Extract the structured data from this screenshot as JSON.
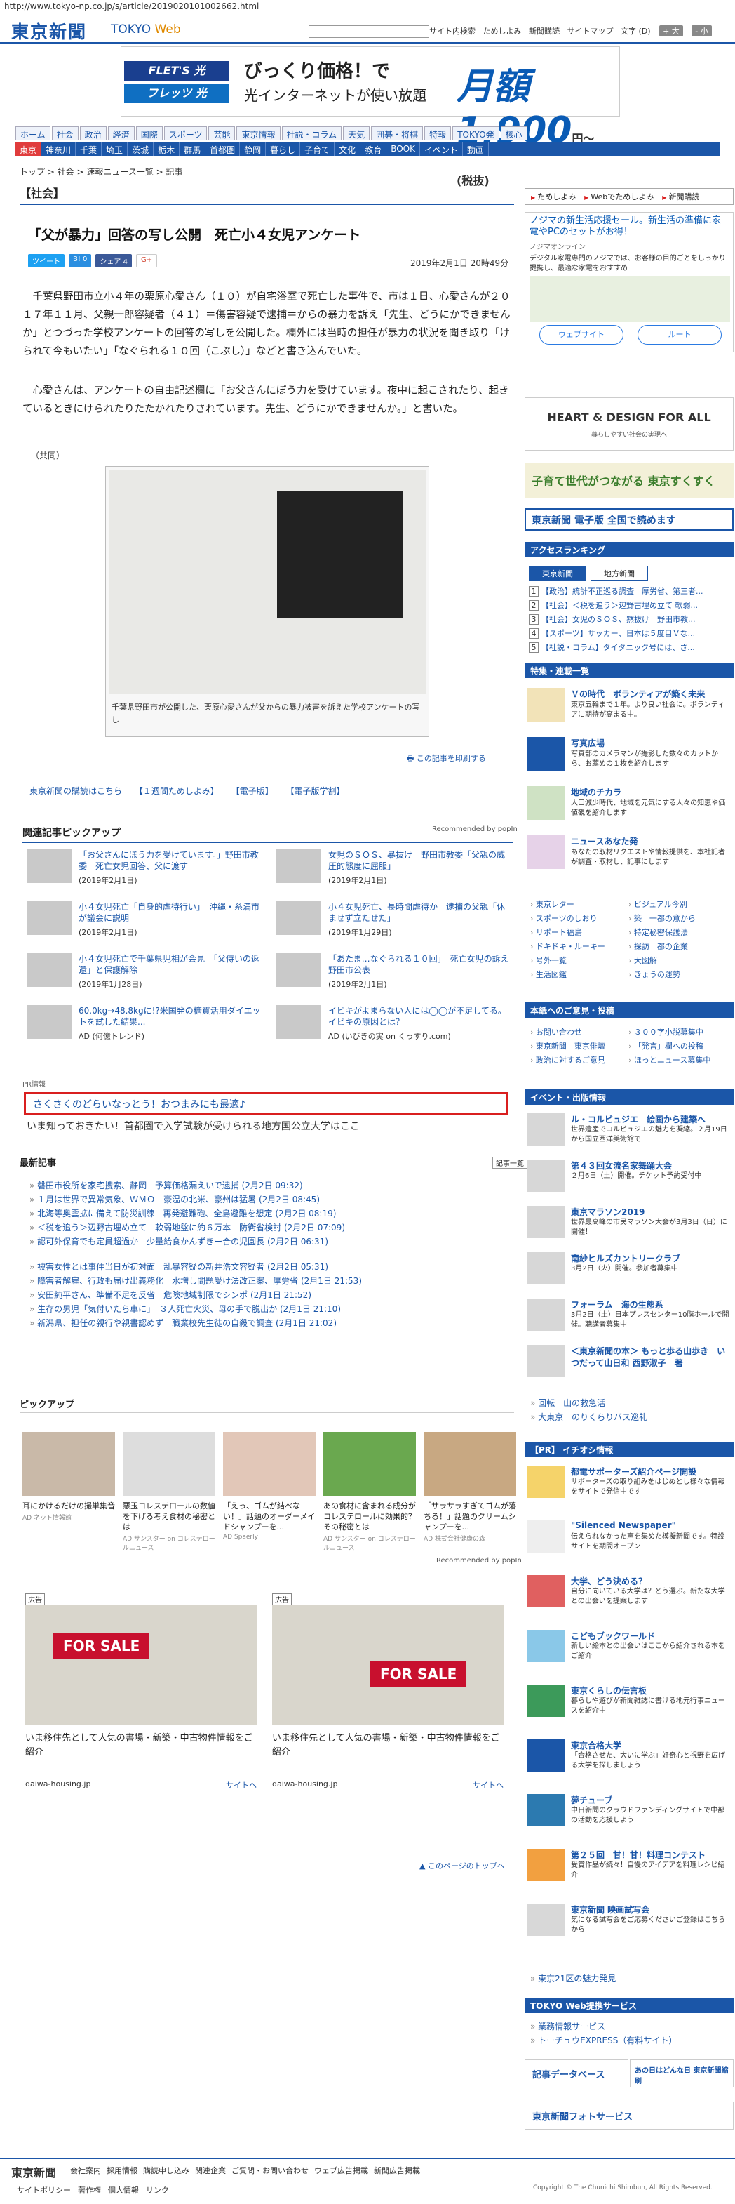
{
  "url": "http://www.tokyo-np.co.jp/s/article/2019020101002662.html",
  "site": {
    "logo": "東京新聞",
    "web": "TOKYO ",
    "web2": "Web"
  },
  "header": {
    "search_btn": "サイト内検索",
    "links": [
      "ためしよみ",
      "新聞購読",
      "サイトマップ"
    ],
    "font_label": "文字 (D)",
    "font_large": "+ 大",
    "font_small": "- 小"
  },
  "ad_top": {
    "brand1": "FLET'S 光",
    "brand2": "フレッツ 光",
    "line1": "びっくり価格！で",
    "line2": "光インターネットが使い放題",
    "price": "月額1,900",
    "yen": "円〜",
    "tax": "(税抜)"
  },
  "nav1": [
    "ホーム",
    "社会",
    "政治",
    "経済",
    "国際",
    "スポーツ",
    "芸能",
    "東京情報",
    "社説・コラム",
    "天気",
    "囲碁・将棋",
    "特報",
    "TOKYO発",
    "核心"
  ],
  "nav2": [
    "東京",
    "神奈川",
    "千葉",
    "埼玉",
    "茨城",
    "栃木",
    "群馬",
    "首都圏",
    "静岡",
    "暮らし",
    "子育て",
    "文化",
    "教育",
    "BOOK",
    "イベント",
    "動画"
  ],
  "breadcrumb": "トップ > 社会 > 速報ニュース一覧 > 記事",
  "section": "【社会】",
  "article": {
    "title": "「父が暴力」回答の写し公開　死亡小４女児アンケート",
    "share": [
      "ツイート",
      "B! 0",
      "シェア 4",
      "G+"
    ],
    "date": "2019年2月1日 20時49分",
    "p1": "千葉県野田市立小４年の栗原心愛さん（１０）が自宅浴室で死亡した事件で、市は１日、心愛さんが２０１７年１１月、父親一郎容疑者（４１）＝傷害容疑で逮捕＝からの暴力を訴え「先生、どうにかできませんか」とつづった学校アンケートの回答の写しを公開した。欄外には当時の担任が暴力の状況を聞き取り「けられて今もいたい」「なぐられる１０回（こぶし）」などと書き込んでいた。",
    "p2": "心愛さんは、アンケートの自由記述欄に「お父さんにぼう力を受けています。夜中に起こされたり、起きているときにけられたりたたかれたりされています。先生、どうにかできませんか。」と書いた。",
    "credit": "（共同）",
    "caption": "千葉県野田市が公開した、栗原心愛さんが父からの暴力被害を訴えた学校アンケートの写し",
    "print": "この記事を印刷する",
    "sublinks": [
      "東京新聞の購読はこちら",
      "【１週間ためしよみ】",
      "【電子版】",
      "【電子版学割】"
    ]
  },
  "related": {
    "heading": "関連記事ピックアップ",
    "rec": "Recommended by popIn",
    "items": [
      {
        "t": "「お父さんにぼう力を受けています。」野田市教委　死亡女児回答、父に渡す",
        "d": "(2019年2月1日)"
      },
      {
        "t": "女児のＳＯＳ、暴抜け　野田市教委「父親の威圧的態度に屈服」",
        "d": "(2019年2月1日)"
      },
      {
        "t": "小４女児死亡「自身的虐待行い」　沖縄・糸満市が議会に説明",
        "d": "(2019年2月1日)"
      },
      {
        "t": "小４女児死亡、長時間虐待か　逮捕の父親「休ませず立たせた」",
        "d": "(2019年1月29日)"
      },
      {
        "t": "小４女児死亡で千葉県児相が会見　「父侍いの返還」と保護解除",
        "d": "(2019年1月28日)"
      },
      {
        "t": "「あたま…なぐられる１０回」　死亡女児の訴え　野田市公表",
        "d": "(2019年2月1日)"
      },
      {
        "t": "60.0kg→48.8kgに!?米国発の糖質活用ダイエットを試した結果...",
        "d": "AD (何億トレンド)"
      },
      {
        "t": "イビキがよまらない人には◯◯が不足してる。イビキの原因とは？",
        "d": "AD (いびきの実 on くっすり.com)"
      }
    ]
  },
  "pr": {
    "tag": "PR情報",
    "box": "さくさくのどらいなっとう！おつまみにも最適♪",
    "line": "いま知っておきたい！首都圏で入学試験が受けられる地方国公立大学はここ"
  },
  "latest": {
    "heading": "最新記事",
    "more": "記事一覧",
    "items": [
      "磐田市役所を家宅捜索、静岡　予算価格漏えいで逮捕 (2月2日 09:32)",
      "１月は世界で異常気象、ＷＭＯ　豪温の北米、豪州は猛暑 (2月2日 08:45)",
      "北海等奥雲拡に備えて防災訓練　再発避難砲、全島避難を想定 (2月2日 08:19)",
      "＜税を追う＞辺野古埋め立て　軟弱地盤に約６万本　防衛省検討 (2月2日 07:09)",
      "認可外保育でも定員超過か　少量給食かんずきー合の児園長 (2月2日 06:31)",
      "被害女性とは事件当日が初対面　乱暴容疑の新井浩文容疑者 (2月2日 05:31)",
      "障害者解雇、行政も届け出義務化　水増し問題受け法改正案、厚労省 (2月1日 21:53)",
      "安田純平さん、準備不足を反省　危険地域制限でシンポ (2月1日 21:52)",
      "生存の男児「気付いたら車に」　３人死亡火災、母の手で脱出か (2月1日 21:10)",
      "新潟県、担任の親行や親書認めず　職業校先生徒の自殺で調査 (2月1日 21:02)"
    ]
  },
  "pickup": {
    "heading": "ピックアップ",
    "rec": "Recommended by popIn",
    "items": [
      {
        "t": "耳にかけるだけの撮単集音",
        "s": "AD ネット情報館"
      },
      {
        "t": "悪玉コレステロールの数値を下げる考え食材の秘密とは",
        "s": "AD サンスター on コレステロールニュース"
      },
      {
        "t": "「えっ、ゴムが結べない！」話題のオーダーメイドシャンプーを...",
        "s": "AD Spaerly"
      },
      {
        "t": "あの食材に含まれる成分がコレステロールに効果的？その秘密とは",
        "s": "AD サンスター on コレステロールニュース"
      },
      {
        "t": "「サラサラすぎてゴムが落ちる！」話題のクリームシャンプーを...",
        "s": "AD 株式会社健康の森"
      }
    ]
  },
  "ads": [
    {
      "label": "広告",
      "txt": "いま移住先として人気の書場・新築・中古物件情報をご紹介",
      "dom": "daiwa-housing.jp",
      "site": "サイトへ"
    },
    {
      "label": "広告",
      "txt": "いま移住先として人気の書場・新築・中古物件情報をご紹介",
      "dom": "daiwa-housing.jp",
      "site": "サイトへ"
    }
  ],
  "pagetop": "このページのトップへ",
  "side": {
    "btns": [
      "ためしよみ",
      "Webでためしよみ",
      "新聞購読"
    ],
    "ad1": {
      "h": "ノジマの新生活応援セール。新生活の準備に家電やPCのセットがお得！",
      "s": "ノジマオンライン",
      "d": "デジタル家電専門のノジマでは、お客様の目的ごとをしっかり提携し、最適な家電をおすすめ",
      "b1": "ウェブサイト",
      "b2": "ルート"
    },
    "hd": {
      "t": "HEART & DESIGN FOR ALL",
      "s": "暮らしやすい社会の実現へ"
    },
    "sukusuku": "子育て世代がつながる 東京すくすく",
    "digital": "東京新聞 電子版 全国で読めます",
    "rank": {
      "heading": "アクセスランキング",
      "tab1": "東京新聞",
      "tab2": "地方新聞",
      "items": [
        "【政治】統計不正巡る調査　厚労省、第三者...",
        "【社会】＜税を追う＞辺野古埋め立て 軟弱...",
        "【社会】女児のＳＯＳ、黙抜け　野田市教...",
        "【スポーツ】サッカー、日本は５度目Ｖな...",
        "【社説・コラム】タイタニック号には、さ..."
      ]
    },
    "special": {
      "heading": "特集・連載一覧",
      "items": [
        {
          "t": "Ｖの時代　ボランティアが築く未来",
          "d": "東京五輪まで１年。より良い社会に。ボランティアに期待が高まる中。"
        },
        {
          "t": "写真広場",
          "d": "写真部のカメラマンが撮影した数々のカットから、お薦めの１枚を紹介します"
        },
        {
          "t": "地域のチカラ",
          "d": "人口減少時代、地域を元気にする人々の知恵や価値観を紹介します"
        },
        {
          "t": "ニュースあなた発",
          "d": "あなたの取材リクエストや情報提供を、本社記者が調査・取材し、記事にします"
        }
      ]
    },
    "grid": [
      "東京レター",
      "ビジュアル今別",
      "スポーツのしおり",
      "築　一都の意から",
      "リポート福島",
      "特定秘密保護法",
      "ドキドキ・ルーキー",
      "探訪　都の企業",
      "号外一覧",
      "大図解",
      "生活図鑑",
      "きょうの運勢"
    ],
    "post": {
      "heading": "本紙へのご意見・投稿",
      "grid": [
        "お問い合わせ",
        "３００字小説募集中",
        "東京新聞　東京俳壇",
        "「発言」欄への投稿",
        "政治に対するご意見",
        "ほっとニュース募集中"
      ]
    },
    "events": {
      "heading": "イベント・出版情報",
      "items": [
        {
          "t": "ル・コルビュジエ　絵画から建築へ",
          "d": "世界遺産でコルビュジエの魅力を凝縮。２月19日から国立西洋美術館で"
        },
        {
          "t": "第４３回女流名家舞踊大会",
          "d": "２月6日（土）開催。チケット予約受付中"
        },
        {
          "t": "東京マラソン2019",
          "d": "世界最高峰の市民マラソン大会が3月3日（日）に開催！"
        },
        {
          "t": "南紗ヒルズカントリークラブ",
          "d": "3月2日（火）開催。参加者募集中"
        },
        {
          "t": "フォーラム　海の生態系",
          "d": "3月2日（土）日本プレスセンター10階ホールで開催。聴講者募集中"
        },
        {
          "t": "＜東京新聞の本＞ もっと歩る山歩き　いつだって山日和 西野淑子　著",
          "d": ""
        }
      ],
      "misc": [
        "回転　山の救急活",
        "大東京　のりくらりバス巡礼"
      ]
    },
    "pr": {
      "heading": "【PR】 イチオシ情報",
      "items": [
        {
          "t": "都電サポーターズ紹介ページ開設",
          "d": "サポーターズの取り組みをはじめとし様々な情報をサイトで発信中です"
        },
        {
          "t": "\"Silenced Newspaper\"",
          "d": "伝えられなかった声を集めた模擬新聞です。特設サイトを期間オープン"
        },
        {
          "t": "大学、どう決める？",
          "d": "自分に向いている大学は？どう選ぶ。新たな大学との出会いを提案します"
        },
        {
          "t": "こどもブックワールド",
          "d": "新しい絵本との出会いはここから紹介される本をご紹介"
        },
        {
          "t": "東京くらしの伝言板",
          "d": "暮らしや遊びが新聞雑誌に書ける地元行事ニュースを紹介中"
        },
        {
          "t": "東京合格大学",
          "d": "「合格させた、大いに学ぶ」好奇心と視野を広げる大学を探しましょう"
        },
        {
          "t": "夢チューブ",
          "d": "中日新聞のクラウドファンディングサイトで中部の活動を応援しよう"
        },
        {
          "t": "第２５回　甘！甘！料理コンテスト",
          "d": "受賞作品が続々！自慢のアイデアを料理レシピ紹介"
        },
        {
          "t": "東京新聞 映画試写会",
          "d": "気になる試写会をご応募くださいご登録はこちらから"
        }
      ],
      "misc": "東京21区の魅力発見"
    },
    "services": {
      "heading": "TOKYO Web提携サービス",
      "items": [
        "業務情報サービス",
        "トーチュウEXPRESS（有料サイト）"
      ]
    },
    "b1": "記事データベース",
    "b2": "あの日はどんな日 東京新聞縮刷",
    "b3": "東京新聞フォトサービス"
  },
  "footer": {
    "logo": "東京新聞",
    "links": [
      "会社案内",
      "採用情報",
      "購読申し込み",
      "関連企業",
      "ご質問・お問い合わせ",
      "ウェブ広告掲載",
      "新聞広告掲載"
    ],
    "links2": [
      "サイトポリシー",
      "著作権",
      "個人情報",
      "リンク"
    ],
    "copy": "Copyright © The Chunichi Shimbun, All Rights Reserved."
  }
}
